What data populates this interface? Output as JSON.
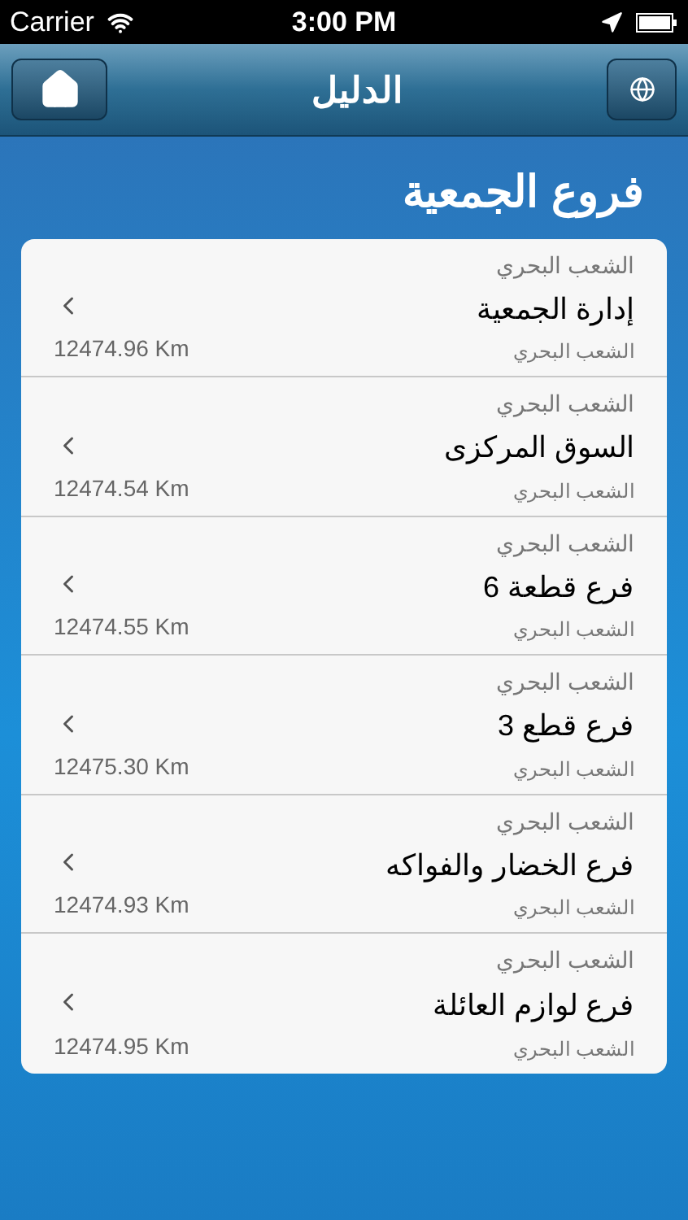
{
  "status_bar": {
    "carrier": "Carrier",
    "time": "3:00 PM"
  },
  "nav_bar": {
    "title": "الدليل"
  },
  "heading": "فروع الجمعية",
  "branches": [
    {
      "area": "الشعب البحري",
      "name": "إدارة الجمعية",
      "subtitle": "الشعب البحري",
      "distance": "12474.96 Km"
    },
    {
      "area": "الشعب البحري",
      "name": "السوق المركزى",
      "subtitle": "الشعب البحري",
      "distance": "12474.54 Km"
    },
    {
      "area": "الشعب البحري",
      "name": "فرع قطعة 6",
      "subtitle": "الشعب البحري",
      "distance": "12474.55 Km"
    },
    {
      "area": "الشعب البحري",
      "name": "فرع قطع 3",
      "subtitle": "الشعب البحري",
      "distance": "12475.30 Km"
    },
    {
      "area": "الشعب البحري",
      "name": "فرع الخضار والفواكه",
      "subtitle": "الشعب البحري",
      "distance": "12474.93 Km"
    },
    {
      "area": "الشعب البحري",
      "name": "فرع لوازم العائلة",
      "subtitle": "الشعب البحري",
      "distance": "12474.95 Km"
    }
  ]
}
